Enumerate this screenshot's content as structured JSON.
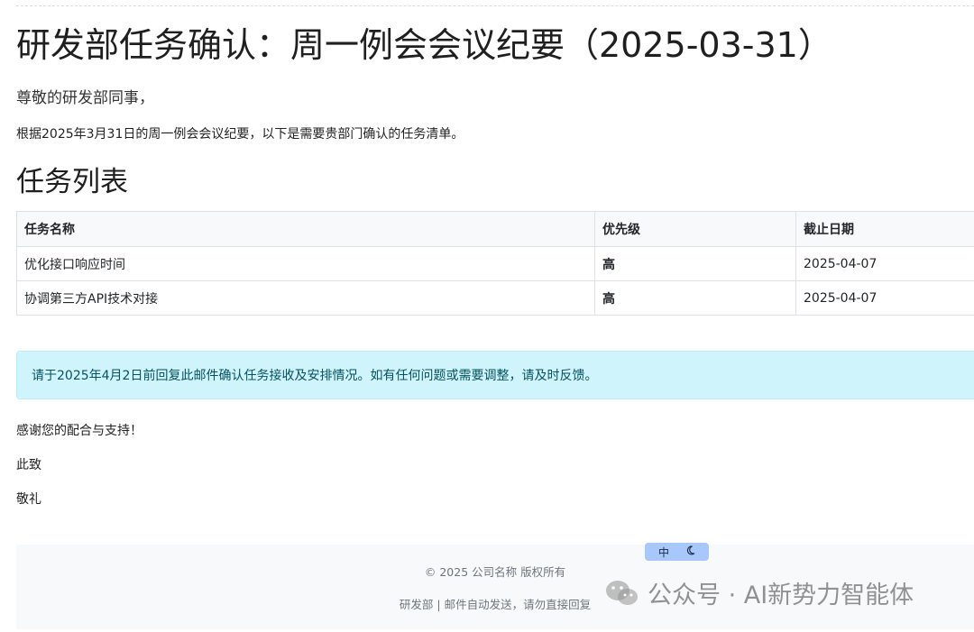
{
  "page": {
    "title": "研发部任务确认：周一例会会议纪要（2025-03-31）",
    "greeting": "尊敬的研发部同事，",
    "intro": "根据2025年3月31日的周一例会会议纪要，以下是需要贵部门确认的任务清单。"
  },
  "task_section": {
    "title": "任务列表",
    "columns": [
      "任务名称",
      "优先级",
      "截止日期"
    ],
    "rows": [
      {
        "name": "优化接口响应时间",
        "priority": "高",
        "due": "2025-04-07"
      },
      {
        "name": "协调第三方API技术对接",
        "priority": "高",
        "due": "2025-04-07"
      }
    ]
  },
  "notice": "请于2025年4月2日前回复此邮件确认任务接收及安排情况。如有任何问题或需要调整，请及时反馈。",
  "closing": {
    "thanks": "感谢您的配合与支持！",
    "line1": "此致",
    "line2": "敬礼"
  },
  "footer": {
    "copyright": "© 2025 公司名称 版权所有",
    "note": "研发部 | 邮件自动发送，请勿直接回复"
  },
  "toolbar": {
    "lang_label": "中",
    "theme_icon": "moon-icon"
  },
  "watermark": {
    "text": "公众号 · AI新势力智能体",
    "icon": "wechat-icon"
  },
  "colors": {
    "notice_bg": "#cff4fc",
    "notice_text": "#055160",
    "table_header_bg": "#f8f9fa",
    "footer_bg": "#f8f9fa",
    "toggle_bg": "#a8c7fa"
  }
}
